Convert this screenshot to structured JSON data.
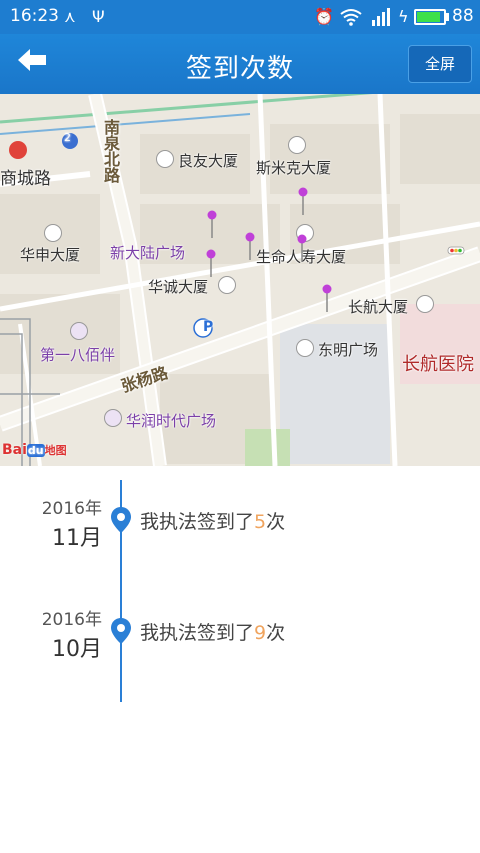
{
  "status_bar": {
    "time": "16:23",
    "battery_percent": "88",
    "battery_level": 0.88
  },
  "app_bar": {
    "title": "签到次数",
    "fullscreen_label": "全屏"
  },
  "map": {
    "poi": {
      "liangyou": "良友大厦",
      "simike": "斯米克大厦",
      "huashen": "华申大厦",
      "xindalu": "新大陆广场",
      "shengming": "生命人寿大厦",
      "huacheng": "华诚大厦",
      "changhang_tower": "长航大厦",
      "dongming": "东明广场",
      "changhang_hospital": "长航医院",
      "diyi_babaiban": "第一八佰伴",
      "huarun": "华润时代广场",
      "shangcheng_road": "商城路"
    },
    "roads": {
      "nanquanbei": "南泉北路",
      "zhangyang": "张杨路"
    },
    "metro_line_number": "2",
    "logo": {
      "bai": "Bai",
      "du": "du",
      "ditu": "地图"
    }
  },
  "timeline": {
    "entries": [
      {
        "year": "2016年",
        "month": "11月",
        "prefix": "我执法签到了",
        "count": "5",
        "suffix": "次"
      },
      {
        "year": "2016年",
        "month": "10月",
        "prefix": "我执法签到了",
        "count": "9",
        "suffix": "次"
      }
    ]
  },
  "colors": {
    "primary": "#1e7dd0",
    "accent_count": "#f0a45e",
    "timeline_line": "#2a7fd6"
  }
}
